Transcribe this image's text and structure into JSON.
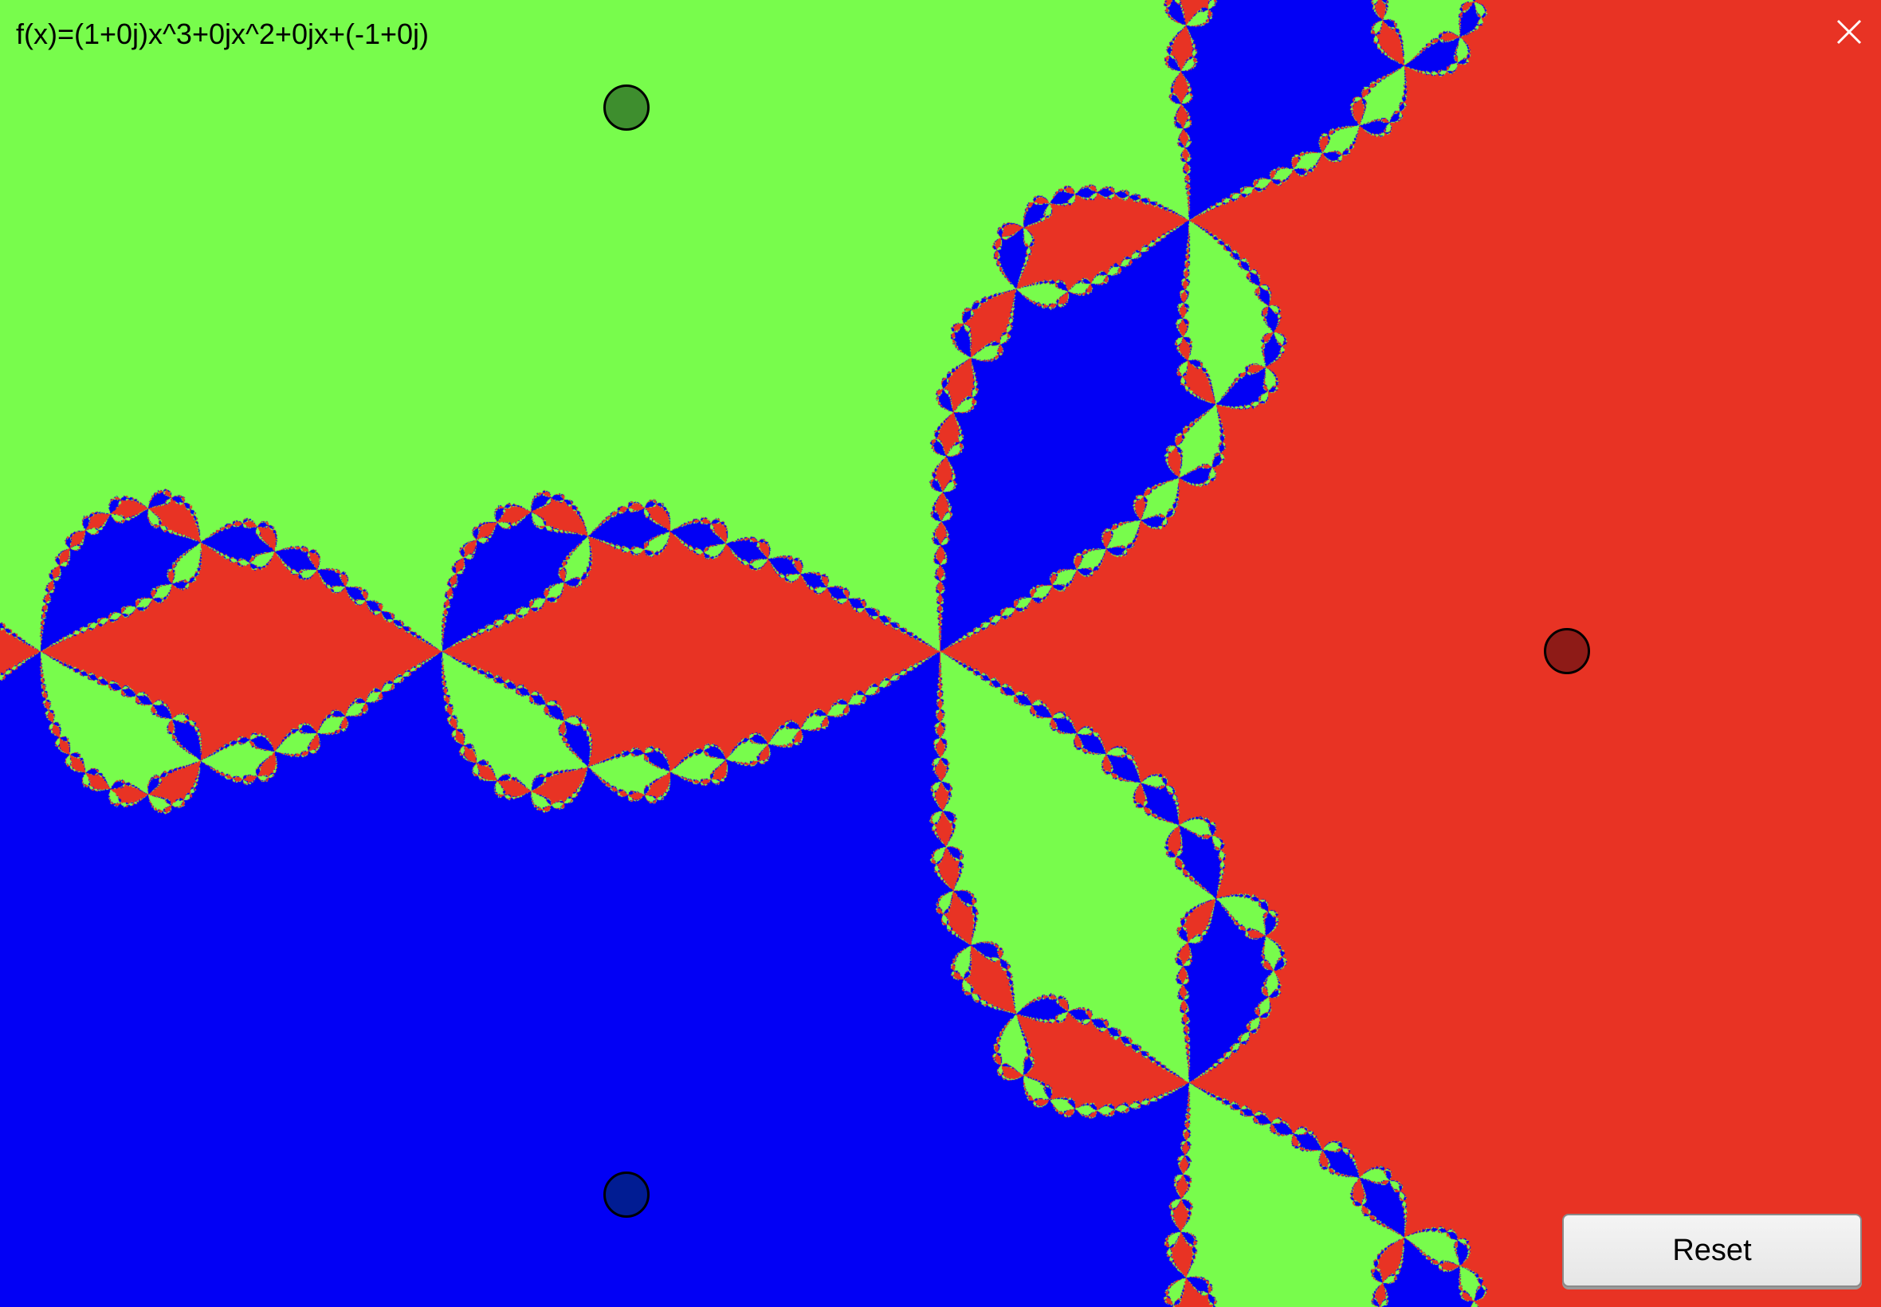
{
  "formula": {
    "text": "f(x)=(1+0j)x^3+0jx^2+0jx+(-1+0j)"
  },
  "polynomial": {
    "coefficients": [
      {
        "re": 1,
        "im": 0
      },
      {
        "re": 0,
        "im": 0
      },
      {
        "re": 0,
        "im": 0
      },
      {
        "re": -1,
        "im": 0
      }
    ]
  },
  "roots": [
    {
      "name": "root-red-handle",
      "re": 1,
      "im": 0,
      "basin_color": "#e83324",
      "handle_color": "#8e1b17"
    },
    {
      "name": "root-green-handle",
      "re": -0.5,
      "im": 0.866,
      "basin_color": "#78fc4c",
      "handle_color": "#3e8e2e"
    },
    {
      "name": "root-blue-handle",
      "re": -0.5,
      "im": -0.866,
      "basin_color": "#0200f5",
      "handle_color": "#011c93"
    }
  ],
  "toolbar": {
    "reset_label": "Reset"
  },
  "icons": {
    "close": "close-icon"
  }
}
